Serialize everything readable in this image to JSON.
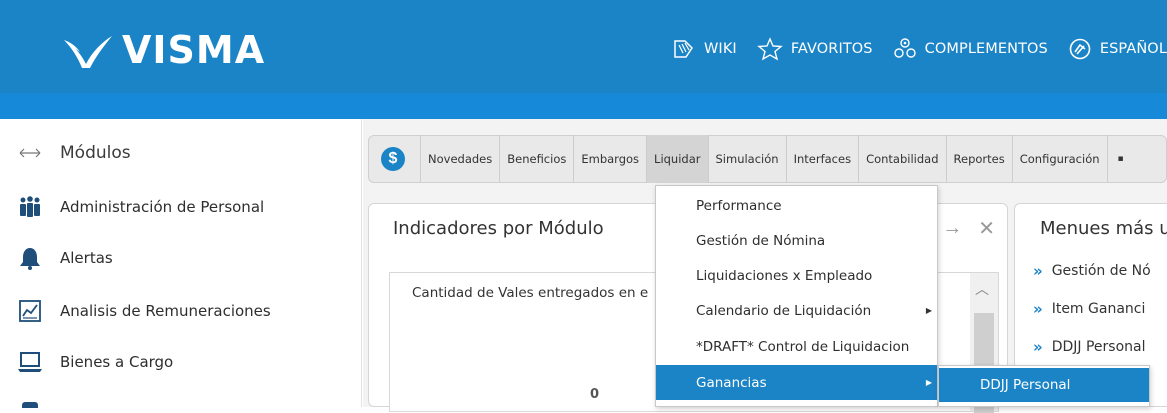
{
  "header": {
    "logo_text": "VISMA",
    "nav": [
      {
        "label": "WIKI",
        "icon": "wiki-icon"
      },
      {
        "label": "FAVORITOS",
        "icon": "star-icon"
      },
      {
        "label": "COMPLEMENTOS",
        "icon": "puzzle-icon"
      },
      {
        "label": "ESPAÑOL",
        "icon": "language-icon"
      }
    ],
    "colors": {
      "primary": "#1b84c7",
      "subbar": "#168ad8"
    }
  },
  "sidebar": {
    "title": "Módulos",
    "items": [
      {
        "label": "Administración de Personal",
        "icon": "people-icon"
      },
      {
        "label": "Alertas",
        "icon": "bell-icon"
      },
      {
        "label": "Analisis de Remuneraciones",
        "icon": "chart-icon"
      },
      {
        "label": "Bienes a Cargo",
        "icon": "laptop-icon"
      }
    ]
  },
  "tabs": {
    "items": [
      "Novedades",
      "Beneficios",
      "Embargos",
      "Liquidar",
      "Simulación",
      "Interfaces",
      "Contabilidad",
      "Reportes",
      "Configuración"
    ],
    "active": "Liquidar"
  },
  "panel_left": {
    "title": "Indicadores por Módulo",
    "chart_title": "Cantidad de Vales entregados en e",
    "chart_value": "0"
  },
  "panel_right": {
    "title": "Menues más u",
    "items": [
      "Gestión de Nó",
      "Item Gananci",
      "DDJJ Personal"
    ]
  },
  "dropdown": {
    "items": [
      {
        "label": "Performance",
        "has_submenu": false
      },
      {
        "label": "Gestión de Nómina",
        "has_submenu": false
      },
      {
        "label": "Liquidaciones x Empleado",
        "has_submenu": false
      },
      {
        "label": "Calendario de Liquidación",
        "has_submenu": true
      },
      {
        "label": "*DRAFT* Control de Liquidacion",
        "has_submenu": false
      },
      {
        "label": "Ganancias",
        "has_submenu": true
      }
    ],
    "active": "Ganancias",
    "submenu": [
      "DDJJ Personal"
    ]
  }
}
